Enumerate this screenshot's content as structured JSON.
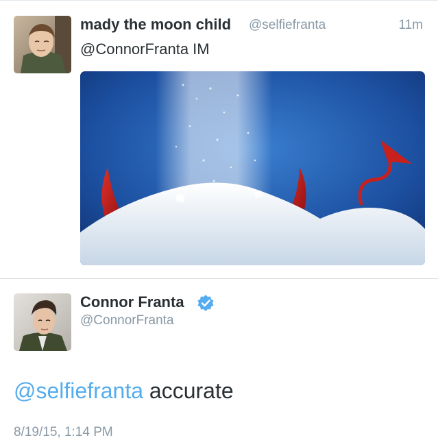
{
  "tweet": {
    "author_name": "mady the moon child",
    "author_handle": "@selfiefranta",
    "time": "11m",
    "text": "@ConnorFranta IM",
    "media": {
      "description_icon": "photo-icon"
    }
  },
  "reply": {
    "author_name": "Connor Franta",
    "author_handle": "@ConnorFranta",
    "verified": true,
    "mention": "@selfiefranta",
    "text": " accurate",
    "timestamp": "8/19/15, 1:14 PM"
  },
  "colors": {
    "link": "#55acee",
    "muted": "#8899a6",
    "text": "#292f33",
    "verified": "#55acee"
  }
}
